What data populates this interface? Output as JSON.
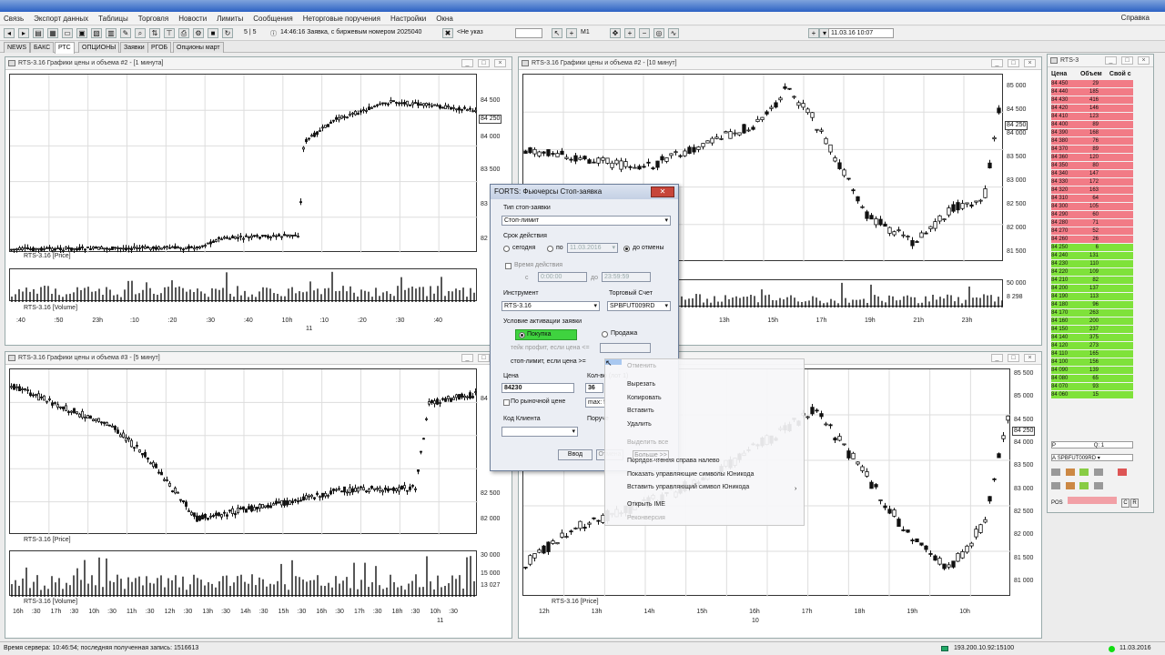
{
  "menu": [
    "Связь",
    "Экспорт данных",
    "Таблицы",
    "Торговля",
    "Новости",
    "Лимиты",
    "Сообщения",
    "Неторговые поручения",
    "Настройки",
    "Окна"
  ],
  "menu_help": "Справка",
  "toolbar": {
    "counter": "5 | 5",
    "message": "14:46:16 Заявка, с биржевым номером 2025040",
    "not_specified": "<Не указ",
    "interval": "M1",
    "datetime": "11.03.16 10:07"
  },
  "tabs": [
    "NEWS",
    "БАКС",
    "РТС",
    "ОПЦИОНЫ",
    "Заявки",
    "РГОБ",
    "Опционы март"
  ],
  "active_tab": "РТС",
  "windows": {
    "w1": {
      "title": "RTS-3.16 Графики цены и объема #2 - [1 минута]",
      "price_label": "RTS-3.16 [Price]",
      "volume_label": "RTS-3.16 [Volume]",
      "price_ticks": [
        "84 500",
        "84 000",
        "83 500",
        "83",
        "82"
      ],
      "cur_price": "84 250",
      "x_ticks": [
        ":40",
        ":50",
        "23h",
        ":10",
        ":20",
        ":30",
        ":40",
        "10h",
        ":10",
        ":20",
        ":30",
        ":40"
      ],
      "date_mark": "11"
    },
    "w2": {
      "title": "RTS-3.16 Графики цены и объема #2 - [10 минут]",
      "price_ticks": [
        "85 000",
        "84 500",
        "84 000",
        "83 500",
        "83 000",
        "82 500",
        "82 000",
        "81 500"
      ],
      "cur_price": "84 250",
      "vol_ticks": [
        "50 000",
        "8 298"
      ],
      "x_ticks": [
        "13h",
        "15h",
        "17h",
        "19h",
        "21h",
        "23h"
      ]
    },
    "w3": {
      "title": "RTS-3.16 Графики цены и объема #3 - [5 минут]",
      "price_label": "RTS-3.16 [Price]",
      "volume_label": "RTS-3.16 [Volume]",
      "price_ticks": [
        "84",
        "82 500",
        "82 000"
      ],
      "vol_ticks": [
        "30 000",
        "15 000",
        "13 027"
      ],
      "x_ticks": [
        "16h",
        ":30",
        "17h",
        ":30",
        "10h",
        ":30",
        "11h",
        ":30",
        "12h",
        ":30",
        "13h",
        ":30",
        "14h",
        ":30",
        "15h",
        ":30",
        "16h",
        ":30",
        "17h",
        ":30",
        "18h",
        ":30",
        "10h",
        ":30"
      ],
      "date_mark": "11"
    },
    "w4": {
      "title": "",
      "price_label": "RTS-3.16 [Price]",
      "price_ticks": [
        "85 500",
        "85 000",
        "84 500",
        "84 000",
        "83 500",
        "83 000",
        "82 500",
        "82 000",
        "81 500",
        "81 000"
      ],
      "cur_price": "84 250",
      "x_ticks": [
        "12h",
        "13h",
        "14h",
        "15h",
        "16h",
        "17h",
        "18h",
        "19h",
        "10h"
      ],
      "date_mark": "10"
    }
  },
  "dialog": {
    "title": "FORTS: Фьючерсы Стоп-заявка",
    "type_label": "Тип стоп-заявки",
    "type_value": "Стоп-лимит",
    "term_label": "Срок действия",
    "term_today": "сегодня",
    "term_until": "по",
    "term_date": "11.03.2016",
    "term_cancel": "до отмены",
    "time_label": "Время действия",
    "time_from_prefix": "с",
    "time_from": "0:00:00",
    "time_to_prefix": "до",
    "time_to": "23:59:59",
    "instrument_label": "Инструмент",
    "instrument_value": "RTS-3.16",
    "account_label": "Торговый Счет",
    "account_value": "SPBFUT009RD",
    "condition_label": "Условие активации заявки",
    "buy": "Покупка",
    "sell": "Продажа",
    "take_profit": "тейк профит, если цена <=",
    "stop_limit": "стоп-лимит, если цена >=",
    "price_label": "Цена",
    "price_value": "84230",
    "qty_label": "Кол-во (лот 1)",
    "qty_value": "36",
    "market_price": "По рыночной цене",
    "max_value": "max: 5",
    "client_label": "Код Клиента",
    "order_label": "Поруче",
    "ok": "Ввод",
    "cancel": "Отмена",
    "more": "Больше >>"
  },
  "context_menu": [
    {
      "label": "Отменить",
      "disabled": true
    },
    {
      "label": "Вырезать",
      "disabled": false
    },
    {
      "label": "Копировать",
      "disabled": false
    },
    {
      "label": "Вставить",
      "disabled": false
    },
    {
      "label": "Удалить",
      "disabled": false
    },
    {
      "label": "Выделить все",
      "disabled": true
    },
    {
      "label": "Порядок чтения справа налево",
      "disabled": false
    },
    {
      "label": "Показать управляющие символы Юникода",
      "disabled": false
    },
    {
      "label": "Вставить управляющий символ Юникода",
      "disabled": false
    },
    {
      "label": "Открыть IME",
      "disabled": false
    },
    {
      "label": "Реконверсия",
      "disabled": true
    }
  ],
  "orderbook": {
    "title": "RTS-3",
    "headers": [
      "Цена",
      "Объем",
      "Свой с"
    ],
    "sell": [
      [
        "84 450",
        "29"
      ],
      [
        "84 440",
        "185"
      ],
      [
        "84 430",
        "416"
      ],
      [
        "84 420",
        "146"
      ],
      [
        "84 410",
        "123"
      ],
      [
        "84 400",
        "89"
      ],
      [
        "84 390",
        "168"
      ],
      [
        "84 380",
        "76"
      ],
      [
        "84 370",
        "89"
      ],
      [
        "84 360",
        "120"
      ],
      [
        "84 350",
        "80"
      ],
      [
        "84 340",
        "147"
      ],
      [
        "84 330",
        "172"
      ],
      [
        "84 320",
        "163"
      ],
      [
        "84 310",
        "64"
      ],
      [
        "84 300",
        "105"
      ],
      [
        "84 290",
        "60"
      ],
      [
        "84 280",
        "71"
      ],
      [
        "84 270",
        "52"
      ],
      [
        "84 260",
        "26"
      ]
    ],
    "buy": [
      [
        "84 250",
        "6"
      ],
      [
        "84 240",
        "131"
      ],
      [
        "84 230",
        "110"
      ],
      [
        "84 220",
        "109"
      ],
      [
        "84 210",
        "82"
      ],
      [
        "84 200",
        "137"
      ],
      [
        "84 190",
        "113"
      ],
      [
        "84 180",
        "96"
      ],
      [
        "84 170",
        "263"
      ],
      [
        "84 160",
        "200"
      ],
      [
        "84 150",
        "237"
      ],
      [
        "84 140",
        "375"
      ],
      [
        "84 120",
        "273"
      ],
      [
        "84 110",
        "165"
      ],
      [
        "84 100",
        "156"
      ],
      [
        "84 090",
        "139"
      ],
      [
        "84 080",
        "65"
      ],
      [
        "84 070",
        "93"
      ],
      [
        "84 060",
        "15"
      ]
    ],
    "p_label": "P",
    "q_label": "Q: 1",
    "a_label": "A",
    "account": "SPBFUT009RD",
    "pos_label": "POS",
    "sell_color": "#f27b86",
    "buy_color": "#7fe23a"
  },
  "status": {
    "text": "Время сервера: 10:46:54; последняя полученная запись: 1516613",
    "ip": "193.200.10.92:15100",
    "date": "11.03.2016"
  }
}
